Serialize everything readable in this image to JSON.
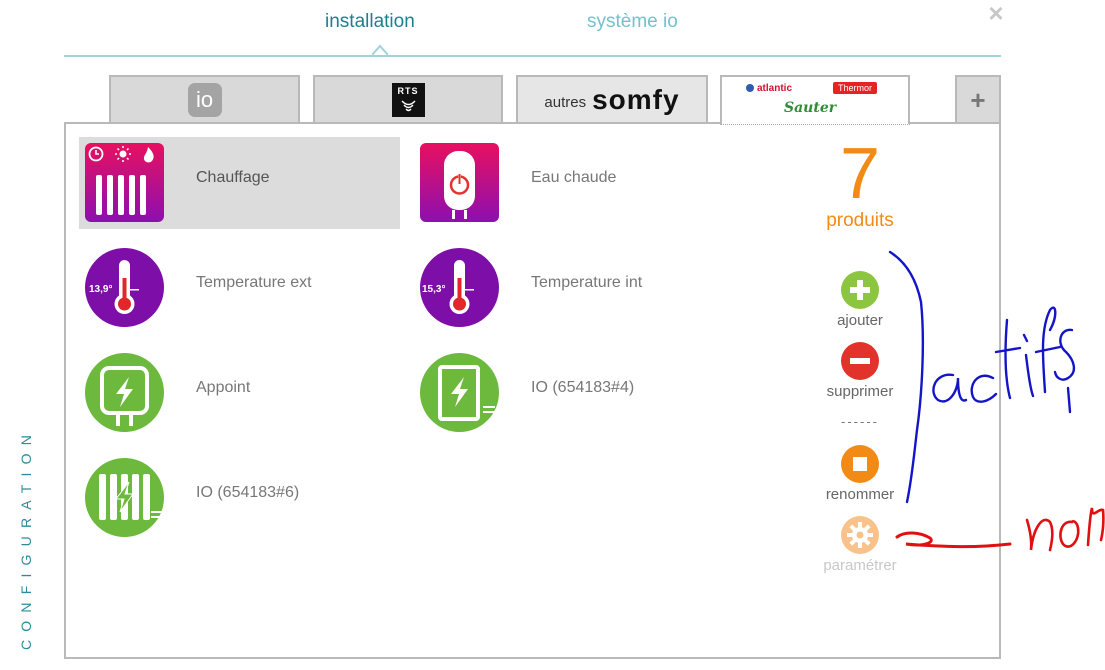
{
  "top_tabs": {
    "installation": "installation",
    "system": "système io"
  },
  "side_label": "CONFIGURATION",
  "protocol_tabs": {
    "io": "io",
    "rts": "RTS",
    "somfy_prefix": "autres",
    "somfy": "somfy",
    "atlantic": "atlantic",
    "thermor": "Thermor",
    "sauter": "Sauter",
    "plus": "+"
  },
  "devices": [
    {
      "label": "Chauffage",
      "icon": "radiator-icon",
      "selected": true
    },
    {
      "label": "Eau chaude",
      "icon": "water-heater-icon",
      "selected": false
    },
    {
      "label": "Temperature ext",
      "icon": "thermometer-icon",
      "value": "13,9°"
    },
    {
      "label": "Temperature int",
      "icon": "thermometer-icon",
      "value": "15,3°"
    },
    {
      "label": "Appoint",
      "icon": "lightning-icon"
    },
    {
      "label": "IO (654183#4)",
      "icon": "lightning-icon"
    },
    {
      "label": "IO (654183#6)",
      "icon": "lightning-radiator-icon"
    }
  ],
  "summary": {
    "count": "7",
    "label": "produits"
  },
  "actions": {
    "add": "ajouter",
    "remove": "supprimer",
    "separator": "------",
    "rename": "renommer",
    "settings": "paramétrer"
  },
  "annotations": {
    "blue": "actifs",
    "red": "non"
  },
  "colors": {
    "accent": "#1f7f8f",
    "orange": "#f28b16",
    "green": "#8cc540",
    "red": "#e1322b",
    "purple": "#7d0fa8",
    "magenta": "#e8105f"
  }
}
